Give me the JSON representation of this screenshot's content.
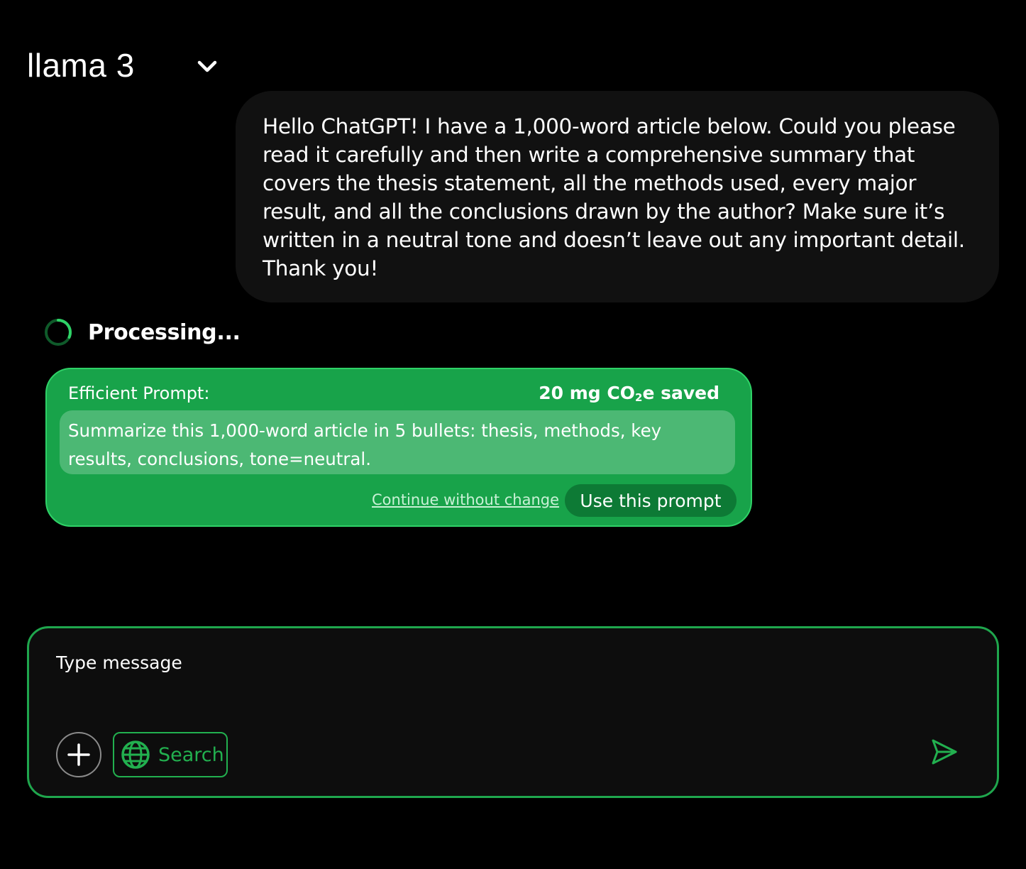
{
  "header": {
    "model_name": "llama 3",
    "model_dropdown_icon": "chevron-down-icon"
  },
  "conversation": {
    "user_message": "Hello ChatGPT! I have a 1,000-word article below. Could you please read it carefully and then write a comprehensive summary that covers the thesis statement, all the methods used, every major result, and all the conclusions drawn by the author? Make sure it’s written in a neutral tone and doesn’t leave out any important detail. Thank you!",
    "status": {
      "label": "Processing...",
      "icon": "spinner-icon"
    }
  },
  "suggestion": {
    "heading": "Efficient Prompt:",
    "savings_prefix": "20 mg CO",
    "savings_subscript": "2",
    "savings_suffix": "e saved",
    "prompt_text": "Summarize this 1,000-word article in 5 bullets: thesis, methods, key results, conclusions, tone=neutral.",
    "continue_label": "Continue without change",
    "use_label": "Use this prompt"
  },
  "composer": {
    "placeholder": "Type message",
    "value": "",
    "add_icon": "plus-icon",
    "search_icon": "globe-icon",
    "search_label": "Search",
    "send_icon": "send-icon"
  },
  "colors": {
    "background": "#000000",
    "bubble": "#111111",
    "accent_green": "#1fa64d",
    "card_green": "#18a34a",
    "card_inner": "#4cb874",
    "button_dark_green": "#0d7a35"
  }
}
